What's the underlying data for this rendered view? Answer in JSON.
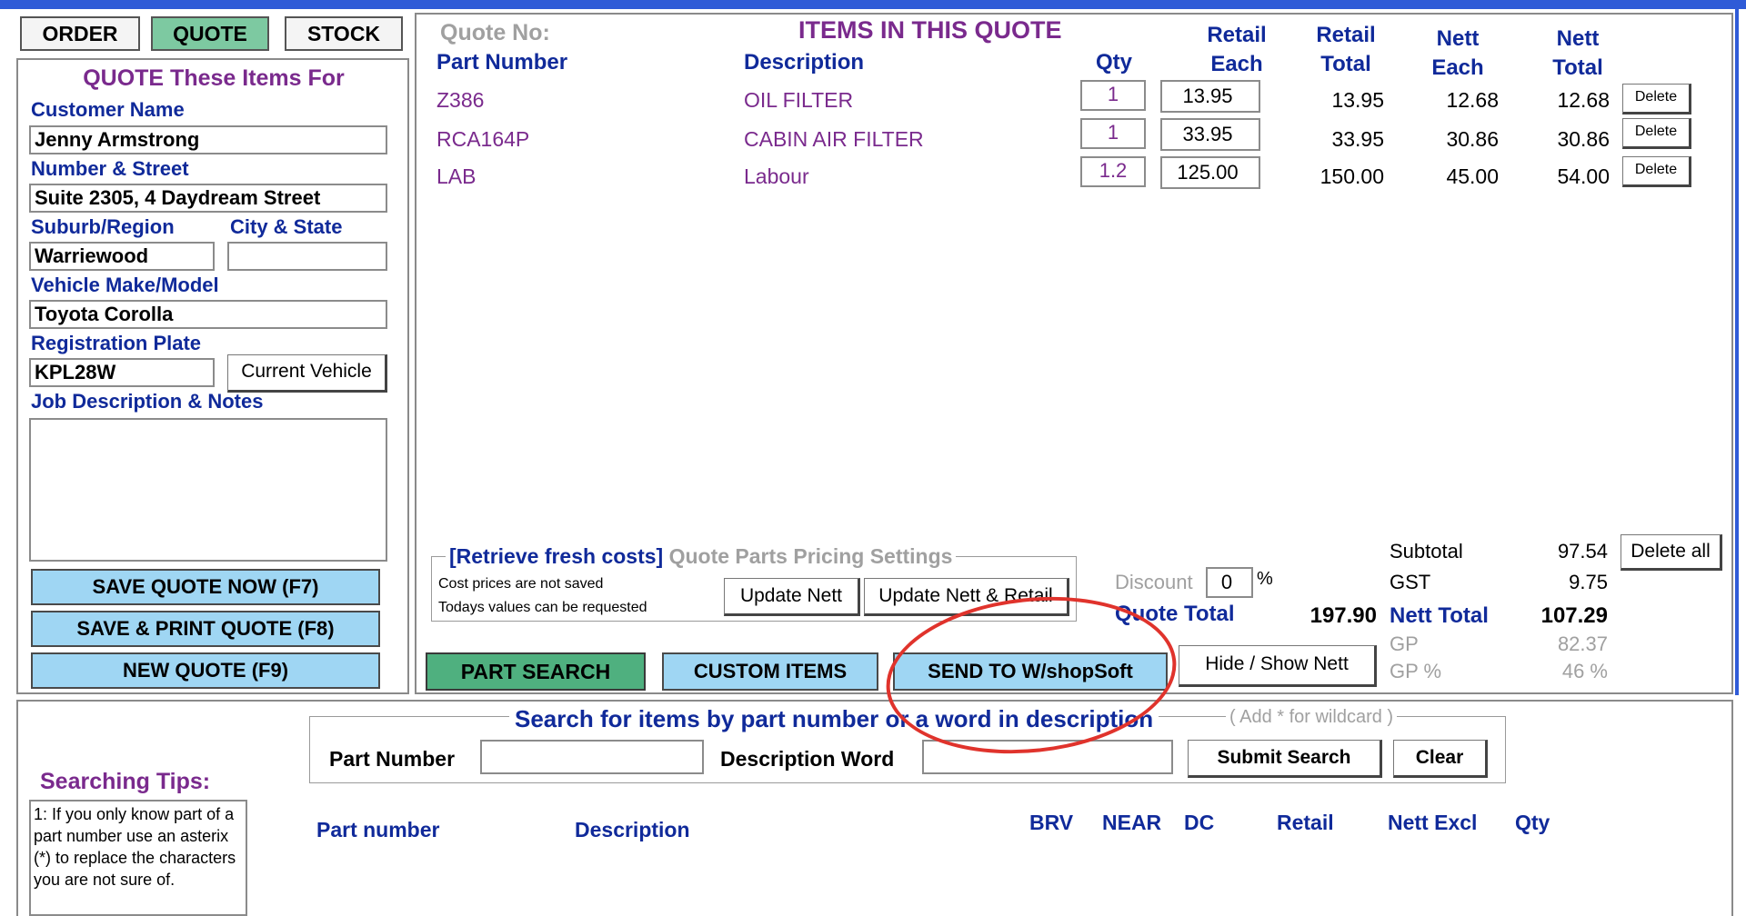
{
  "tabs": {
    "order": "ORDER",
    "quote": "QUOTE",
    "stock": "STOCK"
  },
  "customer": {
    "section_title": "QUOTE These Items For",
    "name_label": "Customer Name",
    "name_value": "Jenny Armstrong",
    "street_label": "Number & Street",
    "street_value": "Suite 2305, 4 Daydream Street",
    "suburb_label": "Suburb/Region",
    "suburb_value": "Warriewood",
    "city_label": "City & State",
    "city_value": "",
    "vehicle_label": "Vehicle Make/Model",
    "vehicle_value": "Toyota Corolla",
    "rego_label": "Registration Plate",
    "rego_value": "KPL28W",
    "current_vehicle_btn": "Current Vehicle",
    "notes_label": "Job Description & Notes",
    "notes_value": ""
  },
  "actions": {
    "save_quote": "SAVE QUOTE NOW (F7)",
    "save_print": "SAVE & PRINT QUOTE (F8)",
    "new_quote": "NEW QUOTE (F9)"
  },
  "quote": {
    "quote_no_label": "Quote No:",
    "items_title": "ITEMS IN THIS QUOTE",
    "headers": {
      "part_number": "Part Number",
      "description": "Description",
      "qty": "Qty",
      "retail_each_1": "Retail",
      "retail_each_2": "Each",
      "retail_total_1": "Retail",
      "retail_total_2": "Total",
      "nett_each_1": "Nett",
      "nett_each_2": "Each",
      "nett_total_1": "Nett",
      "nett_total_2": "Total"
    },
    "delete_label": "Delete",
    "rows": [
      {
        "part": "Z386",
        "desc": "OIL FILTER",
        "qty": "1",
        "retail_each": "13.95",
        "retail_total": "13.95",
        "nett_each": "12.68",
        "nett_total": "12.68"
      },
      {
        "part": "RCA164P",
        "desc": "CABIN AIR FILTER",
        "qty": "1",
        "retail_each": "33.95",
        "retail_total": "33.95",
        "nett_each": "30.86",
        "nett_total": "30.86"
      },
      {
        "part": "LAB",
        "desc": "Labour",
        "qty": "1.2",
        "retail_each": "125.00",
        "retail_total": "150.00",
        "nett_each": "45.00",
        "nett_total": "54.00"
      }
    ]
  },
  "pricing": {
    "retrieve_label": "[Retrieve fresh costs]",
    "settings_label": "Quote Parts Pricing Settings",
    "note_1": "Cost prices are not saved",
    "note_2": "Todays values can be requested",
    "update_nett": "Update Nett",
    "update_nett_retail": "Update Nett & Retail"
  },
  "totals": {
    "discount_label": "Discount",
    "discount_value": "0",
    "discount_unit": "%",
    "quote_total_label": "Quote Total",
    "quote_total_value": "197.90",
    "subtotal_label": "Subtotal",
    "subtotal_value": "97.54",
    "gst_label": "GST",
    "gst_value": "9.75",
    "nett_total_label": "Nett Total",
    "nett_total_value": "107.29",
    "gp_label": "GP",
    "gp_value": "82.37",
    "gp_pct_label": "GP %",
    "gp_pct_value": "46 %",
    "delete_all": "Delete all"
  },
  "bottom_buttons": {
    "part_search": "PART SEARCH",
    "custom_items": "CUSTOM ITEMS",
    "send_to": "SEND TO W/shopSoft",
    "hide_show": "Hide / Show Nett"
  },
  "search": {
    "title": "Search for items by part number or a word in description",
    "wildcard_hint": "( Add * for wildcard )",
    "part_number_label": "Part Number",
    "part_number_value": "",
    "desc_word_label": "Description Word",
    "desc_word_value": "",
    "submit": "Submit Search",
    "clear": "Clear",
    "tips_title": "Searching Tips:",
    "tips_text": "1: If you only know part of a part number use an asterix (*) to replace the characters you are not sure of.",
    "results_headers": {
      "part": "Part number",
      "desc": "Description",
      "brv": "BRV",
      "near": "NEAR",
      "dc": "DC",
      "retail": "Retail",
      "nett": "Nett Excl",
      "qty": "Qty"
    }
  },
  "colors": {
    "accent_blue": "#2f5bd7",
    "quote_tab": "#7dc9a1",
    "action_btn": "#9fd6f3",
    "part_search_btn": "#4fb07f",
    "highlight_circle": "#e0332c"
  }
}
